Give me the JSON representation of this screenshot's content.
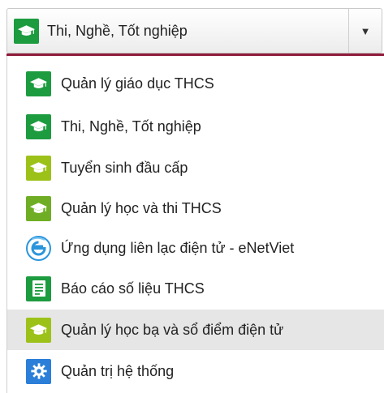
{
  "dropdown": {
    "selected_label": "Thi, Nghề, Tốt nghiệp",
    "selected_icon": "graduation-cap-icon",
    "selected_icon_color": "#1c9b3f",
    "caret_label": "▼"
  },
  "menu": {
    "items": [
      {
        "label": "Quản lý giáo dục THCS",
        "icon": "graduation-cap-icon",
        "color": "#1c9b3f"
      },
      {
        "label": "Thi, Nghề, Tốt nghiệp",
        "icon": "graduation-cap-icon",
        "color": "#1c9b3f"
      },
      {
        "label": "Tuyển sinh đầu cấp",
        "icon": "graduation-cap-icon",
        "color": "#9cc21a"
      },
      {
        "label": "Quản lý học và thi THCS",
        "icon": "graduation-cap-icon",
        "color": "#6fae24"
      },
      {
        "label": "Ứng dụng liên lạc điện tử - eNetViet",
        "icon": "enetviet-logo-icon",
        "color": "#2b95dc"
      },
      {
        "label": "Báo cáo số liệu THCS",
        "icon": "document-icon",
        "color": "#1c9b3f"
      },
      {
        "label": "Quản lý học bạ và sổ điểm điện tử",
        "icon": "graduation-cap-icon",
        "color": "#9cc21a",
        "highlighted": true
      },
      {
        "label": "Quản trị hệ thống",
        "icon": "gear-icon",
        "color": "#2b7fd8"
      }
    ]
  }
}
